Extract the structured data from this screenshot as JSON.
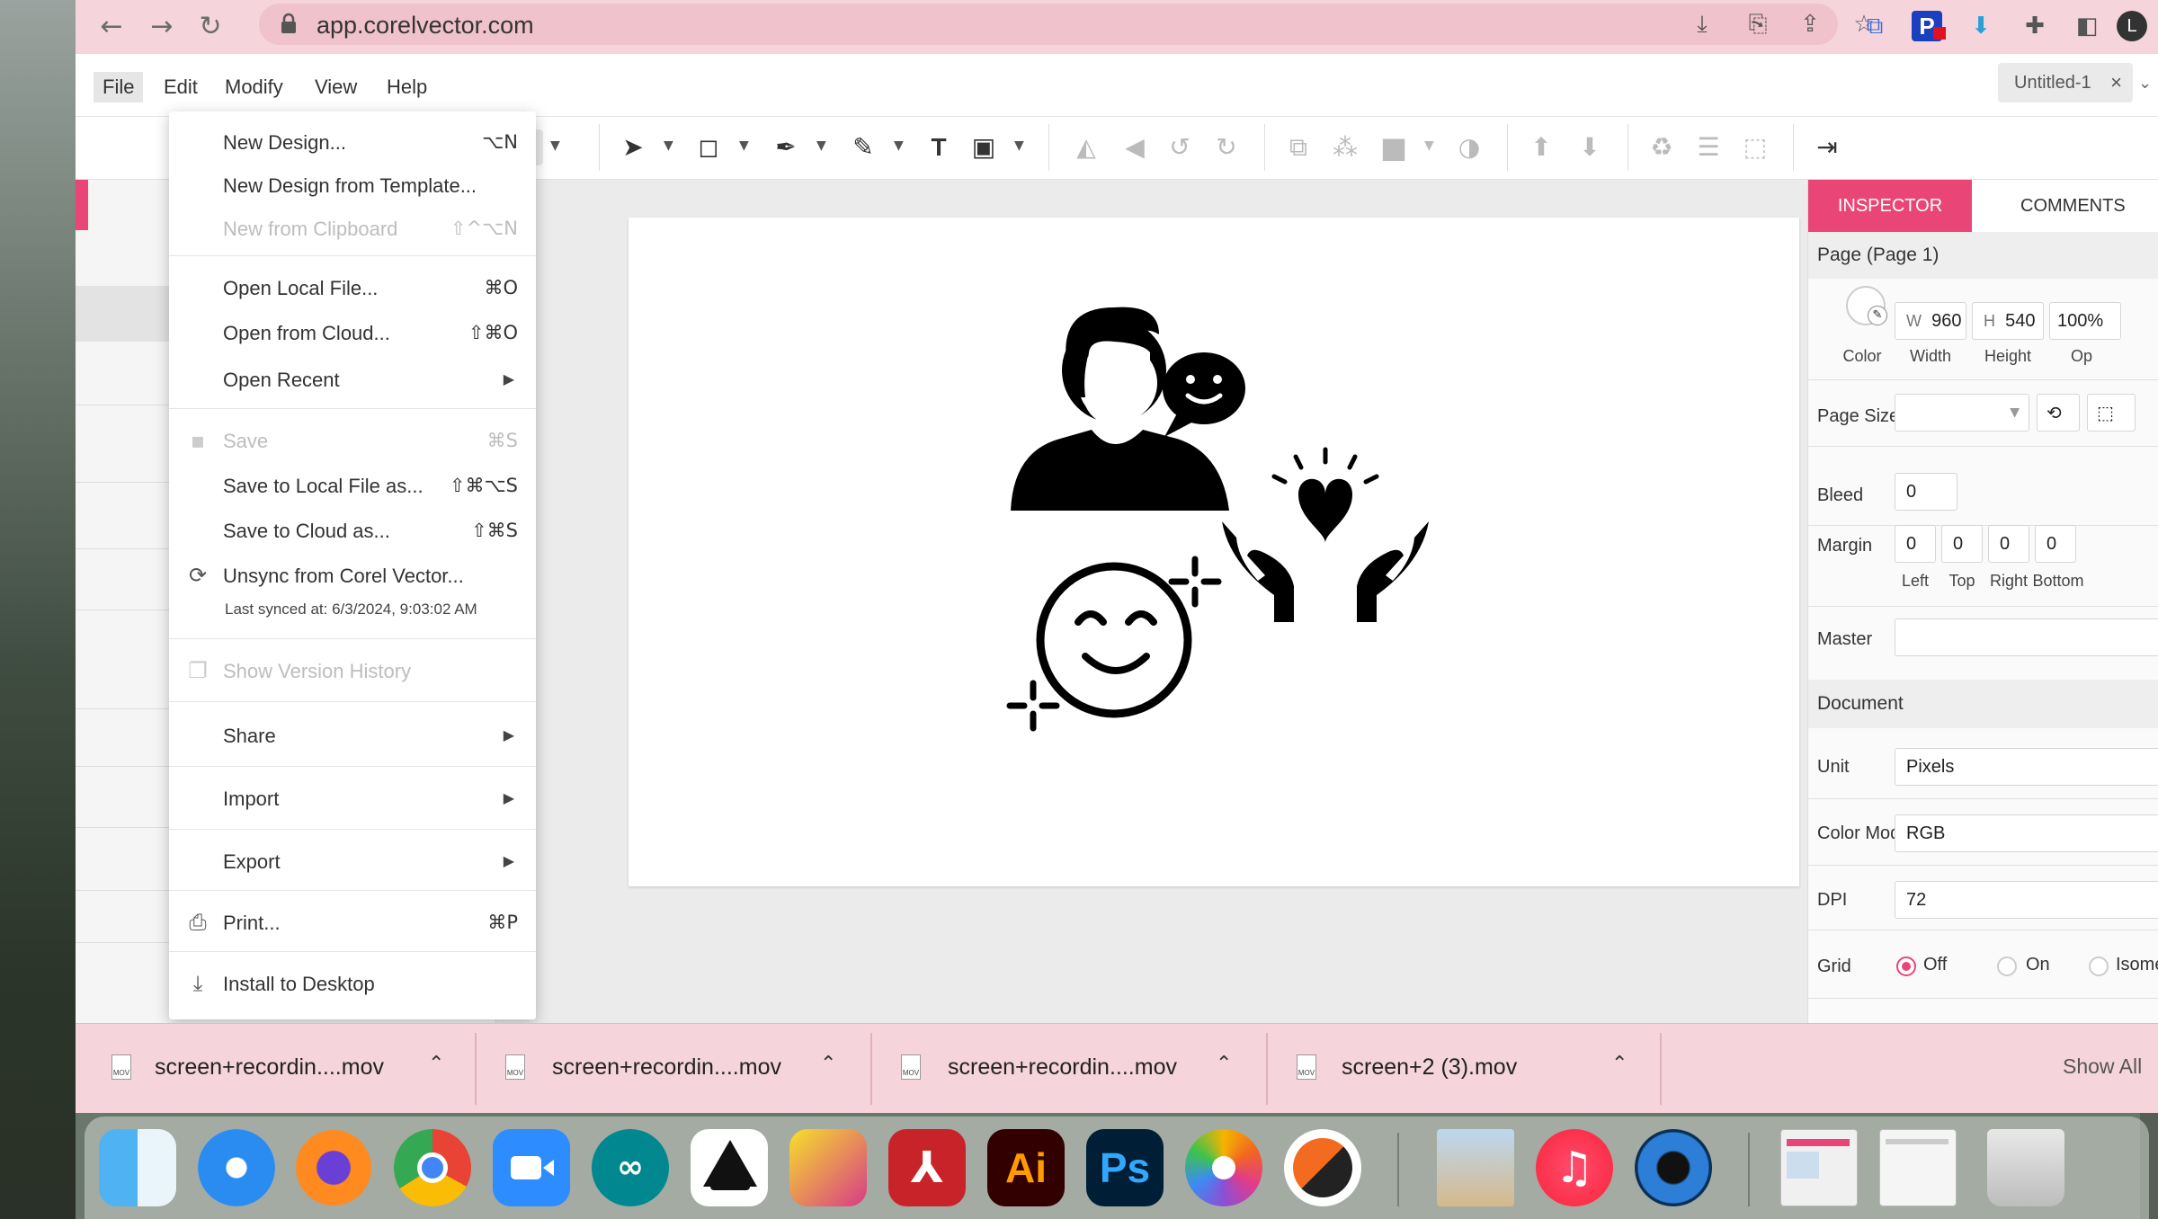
{
  "browser": {
    "url": "app.corelvector.com",
    "profile_initial": "L",
    "extension_badge": "P"
  },
  "app": {
    "menus": [
      "File",
      "Edit",
      "Modify",
      "View",
      "Help"
    ],
    "doc_tab": "Untitled-1",
    "close_glyph": "×"
  },
  "file_menu": {
    "items": [
      {
        "label": "New Design...",
        "shortcut": "⌥N"
      },
      {
        "label": "New Design from Template...",
        "shortcut": ""
      },
      {
        "label": "New from Clipboard",
        "shortcut": "⇧^⌥N"
      },
      {
        "label": "Open Local File...",
        "shortcut": "⌘O"
      },
      {
        "label": "Open from Cloud...",
        "shortcut": "⇧⌘O"
      },
      {
        "label": "Open Recent",
        "shortcut": ""
      },
      {
        "label": "Save",
        "shortcut": "⌘S"
      },
      {
        "label": "Save to Local File as...",
        "shortcut": "⇧⌘⌥S"
      },
      {
        "label": "Save to Cloud as...",
        "shortcut": "⇧⌘S"
      },
      {
        "label": "Unsync from Corel Vector...",
        "shortcut": ""
      },
      {
        "label": "Show Version History",
        "shortcut": ""
      },
      {
        "label": "Share",
        "shortcut": ""
      },
      {
        "label": "Import",
        "shortcut": ""
      },
      {
        "label": "Export",
        "shortcut": ""
      },
      {
        "label": "Print...",
        "shortcut": "⌘P"
      },
      {
        "label": "Install to Desktop",
        "shortcut": ""
      }
    ],
    "last_synced": "Last synced at: 6/3/2024, 9:03:02 AM"
  },
  "inspector": {
    "tabs": [
      "INSPECTOR",
      "COMMENTS"
    ],
    "page_title": "Page (Page 1)",
    "color_label": "Color",
    "w_prefix": "W",
    "width_value": "960",
    "width_label": "Width",
    "h_prefix": "H",
    "height_value": "540",
    "height_label": "Height",
    "opacity_value": "100%",
    "opacity_label": "Op",
    "page_size_label": "Page Size",
    "page_size_value": "",
    "bleed_label": "Bleed",
    "bleed_value": "0",
    "margin_label": "Margin",
    "margin": [
      {
        "value": "0",
        "label": "Left"
      },
      {
        "value": "0",
        "label": "Top"
      },
      {
        "value": "0",
        "label": "Right"
      },
      {
        "value": "0",
        "label": "Bottom"
      }
    ],
    "master_label": "Master",
    "master_value": "",
    "document_section": "Document",
    "unit_label": "Unit",
    "unit_value": "Pixels",
    "color_mode_label": "Color Mode",
    "color_mode_value": "RGB",
    "dpi_label": "DPI",
    "dpi_value": "72",
    "grid_label": "Grid",
    "grid_options": [
      "Off",
      "On",
      "Isome"
    ],
    "grid_selected": "Off"
  },
  "downloads": {
    "items": [
      "screen+recordin....mov",
      "screen+recordin....mov",
      "screen+recordin....mov",
      "screen+2 (3).mov"
    ],
    "file_badge": "MOV",
    "show_all": "Show All"
  },
  "dock": {
    "apps": [
      "finder",
      "safari",
      "firefox",
      "chrome",
      "zoom",
      "arduino",
      "inkscape",
      "affinity",
      "acrobat",
      "illustrator",
      "photoshop",
      "photos",
      "vectornator",
      "preview",
      "music",
      "quicktime",
      "recent-window-1",
      "recent-window-2",
      "trash"
    ],
    "illustrator_label": "Ai",
    "photoshop_label": "Ps"
  },
  "colors": {
    "accent": "#e94677",
    "chrome_pink": "#f6d4dc",
    "omnibox_pink": "#efc2cc"
  }
}
